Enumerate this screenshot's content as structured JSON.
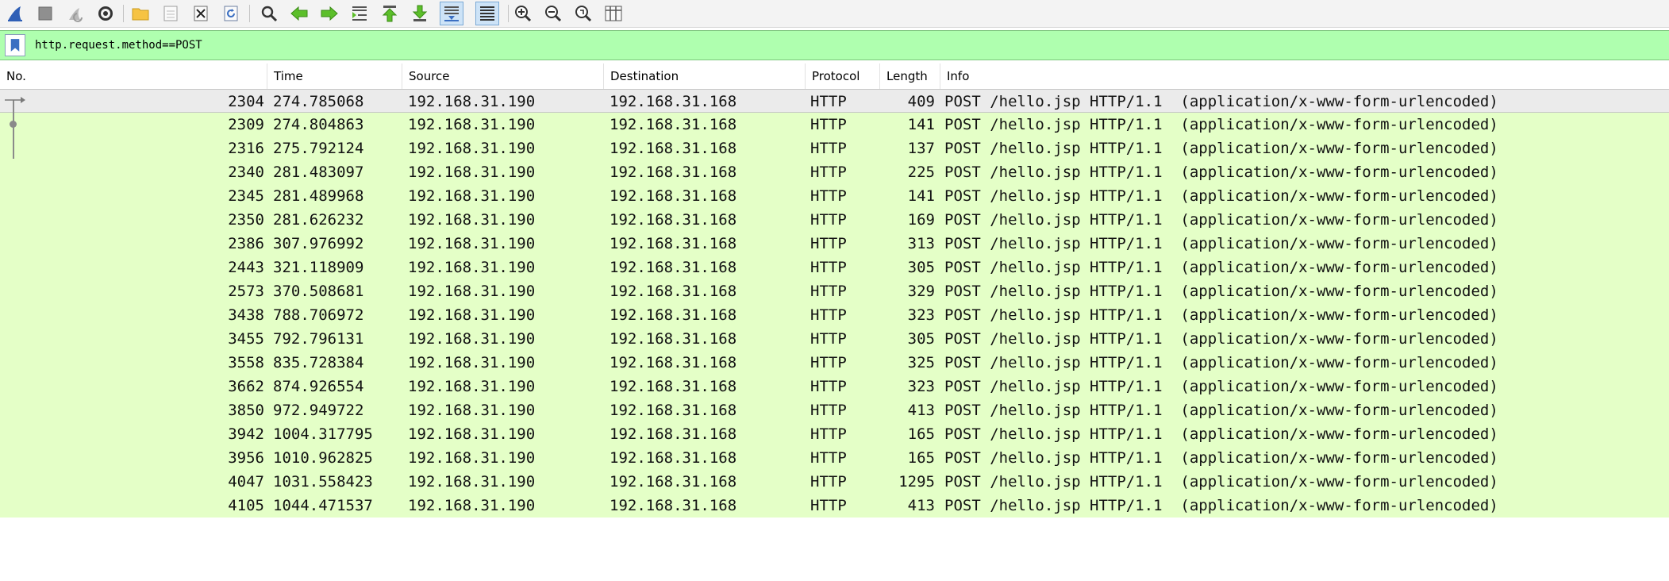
{
  "toolbar": {
    "icons": [
      "shark-fin-icon",
      "stop-icon",
      "restart-icon",
      "gear-icon",
      "open-folder-icon",
      "save-file-icon",
      "close-file-icon",
      "reload-icon",
      "find-icon",
      "back-arrow-icon",
      "forward-arrow-icon",
      "goto-packet-icon",
      "first-packet-icon",
      "last-packet-icon",
      "autoscroll-icon",
      "colorize-icon",
      "zoom-in-icon",
      "zoom-out-icon",
      "zoom-normal-icon",
      "resize-columns-icon"
    ],
    "active": [
      "autoscroll-icon",
      "colorize-icon"
    ]
  },
  "filter": {
    "text": "http.request.method==POST"
  },
  "columns": [
    "No.",
    "Time",
    "Source",
    "Destination",
    "Protocol",
    "Length",
    "Info"
  ],
  "packets": [
    {
      "no": "2304",
      "time": "274.785068",
      "src": "192.168.31.190",
      "dst": "192.168.31.168",
      "proto": "HTTP",
      "len": "409",
      "info": "POST /hello.jsp HTTP/1.1  (application/x-www-form-urlencoded)"
    },
    {
      "no": "2309",
      "time": "274.804863",
      "src": "192.168.31.190",
      "dst": "192.168.31.168",
      "proto": "HTTP",
      "len": "141",
      "info": "POST /hello.jsp HTTP/1.1  (application/x-www-form-urlencoded)"
    },
    {
      "no": "2316",
      "time": "275.792124",
      "src": "192.168.31.190",
      "dst": "192.168.31.168",
      "proto": "HTTP",
      "len": "137",
      "info": "POST /hello.jsp HTTP/1.1  (application/x-www-form-urlencoded)"
    },
    {
      "no": "2340",
      "time": "281.483097",
      "src": "192.168.31.190",
      "dst": "192.168.31.168",
      "proto": "HTTP",
      "len": "225",
      "info": "POST /hello.jsp HTTP/1.1  (application/x-www-form-urlencoded)"
    },
    {
      "no": "2345",
      "time": "281.489968",
      "src": "192.168.31.190",
      "dst": "192.168.31.168",
      "proto": "HTTP",
      "len": "141",
      "info": "POST /hello.jsp HTTP/1.1  (application/x-www-form-urlencoded)"
    },
    {
      "no": "2350",
      "time": "281.626232",
      "src": "192.168.31.190",
      "dst": "192.168.31.168",
      "proto": "HTTP",
      "len": "169",
      "info": "POST /hello.jsp HTTP/1.1  (application/x-www-form-urlencoded)"
    },
    {
      "no": "2386",
      "time": "307.976992",
      "src": "192.168.31.190",
      "dst": "192.168.31.168",
      "proto": "HTTP",
      "len": "313",
      "info": "POST /hello.jsp HTTP/1.1  (application/x-www-form-urlencoded)"
    },
    {
      "no": "2443",
      "time": "321.118909",
      "src": "192.168.31.190",
      "dst": "192.168.31.168",
      "proto": "HTTP",
      "len": "305",
      "info": "POST /hello.jsp HTTP/1.1  (application/x-www-form-urlencoded)"
    },
    {
      "no": "2573",
      "time": "370.508681",
      "src": "192.168.31.190",
      "dst": "192.168.31.168",
      "proto": "HTTP",
      "len": "329",
      "info": "POST /hello.jsp HTTP/1.1  (application/x-www-form-urlencoded)"
    },
    {
      "no": "3438",
      "time": "788.706972",
      "src": "192.168.31.190",
      "dst": "192.168.31.168",
      "proto": "HTTP",
      "len": "323",
      "info": "POST /hello.jsp HTTP/1.1  (application/x-www-form-urlencoded)"
    },
    {
      "no": "3455",
      "time": "792.796131",
      "src": "192.168.31.190",
      "dst": "192.168.31.168",
      "proto": "HTTP",
      "len": "305",
      "info": "POST /hello.jsp HTTP/1.1  (application/x-www-form-urlencoded)"
    },
    {
      "no": "3558",
      "time": "835.728384",
      "src": "192.168.31.190",
      "dst": "192.168.31.168",
      "proto": "HTTP",
      "len": "325",
      "info": "POST /hello.jsp HTTP/1.1  (application/x-www-form-urlencoded)"
    },
    {
      "no": "3662",
      "time": "874.926554",
      "src": "192.168.31.190",
      "dst": "192.168.31.168",
      "proto": "HTTP",
      "len": "323",
      "info": "POST /hello.jsp HTTP/1.1  (application/x-www-form-urlencoded)"
    },
    {
      "no": "3850",
      "time": "972.949722",
      "src": "192.168.31.190",
      "dst": "192.168.31.168",
      "proto": "HTTP",
      "len": "413",
      "info": "POST /hello.jsp HTTP/1.1  (application/x-www-form-urlencoded)"
    },
    {
      "no": "3942",
      "time": "1004.317795",
      "src": "192.168.31.190",
      "dst": "192.168.31.168",
      "proto": "HTTP",
      "len": "165",
      "info": "POST /hello.jsp HTTP/1.1  (application/x-www-form-urlencoded)"
    },
    {
      "no": "3956",
      "time": "1010.962825",
      "src": "192.168.31.190",
      "dst": "192.168.31.168",
      "proto": "HTTP",
      "len": "165",
      "info": "POST /hello.jsp HTTP/1.1  (application/x-www-form-urlencoded)"
    },
    {
      "no": "4047",
      "time": "1031.558423",
      "src": "192.168.31.190",
      "dst": "192.168.31.168",
      "proto": "HTTP",
      "len": "1295",
      "info": "POST /hello.jsp HTTP/1.1  (application/x-www-form-urlencoded)"
    },
    {
      "no": "4105",
      "time": "1044.471537",
      "src": "192.168.31.190",
      "dst": "192.168.31.168",
      "proto": "HTTP",
      "len": "413",
      "info": "POST /hello.jsp HTTP/1.1  (application/x-www-form-urlencoded)"
    }
  ],
  "selected_row": 0,
  "colors": {
    "row_bg": "#e4ffc7",
    "selected_bg": "#ebebeb",
    "filter_valid_bg": "#afffaf"
  }
}
